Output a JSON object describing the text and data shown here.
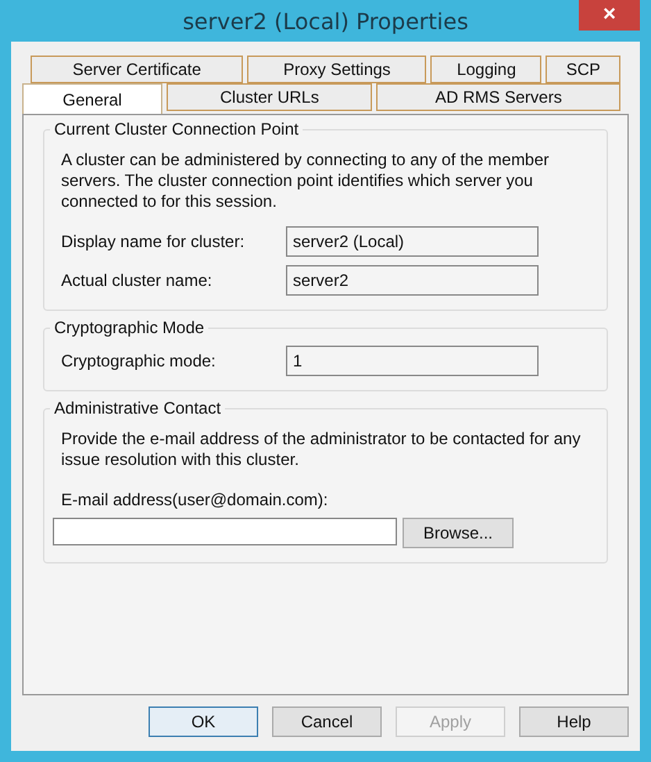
{
  "window": {
    "title": "server2 (Local) Properties",
    "close": "×"
  },
  "tab_rows": [
    [
      {
        "label": "Server Certificate",
        "selected": false
      },
      {
        "label": "Proxy Settings",
        "selected": false
      },
      {
        "label": "Logging",
        "selected": false
      },
      {
        "label": "SCP",
        "selected": false
      }
    ],
    [
      {
        "label": "General",
        "selected": true
      },
      {
        "label": "Cluster URLs",
        "selected": false
      },
      {
        "label": "AD RMS Servers",
        "selected": false
      }
    ]
  ],
  "groups": [
    {
      "title": "Current Cluster Connection Point",
      "description": "A cluster can be administered by connecting to any of the member servers. The cluster connection point identifies which server you connected to for this session.",
      "fields": [
        {
          "label": "Display name for cluster:",
          "value": "server2 (Local)"
        },
        {
          "label": "Actual cluster name:",
          "value": "server2"
        }
      ]
    },
    {
      "title": "Cryptographic Mode",
      "fields": [
        {
          "label": "Cryptographic mode:",
          "value": "1"
        }
      ]
    },
    {
      "title": "Administrative Contact",
      "description": "Provide the e-mail address of the administrator to be contacted for any issue resolution with this cluster.",
      "email": {
        "label": "E-mail address(user@domain.com):",
        "browse": "Browse..."
      }
    }
  ],
  "buttons": [
    {
      "label": "OK",
      "default": true,
      "disabled": false
    },
    {
      "label": "Cancel",
      "default": false,
      "disabled": false
    },
    {
      "label": "Apply",
      "default": false,
      "disabled": true
    },
    {
      "label": "Help",
      "default": false,
      "disabled": false
    }
  ]
}
